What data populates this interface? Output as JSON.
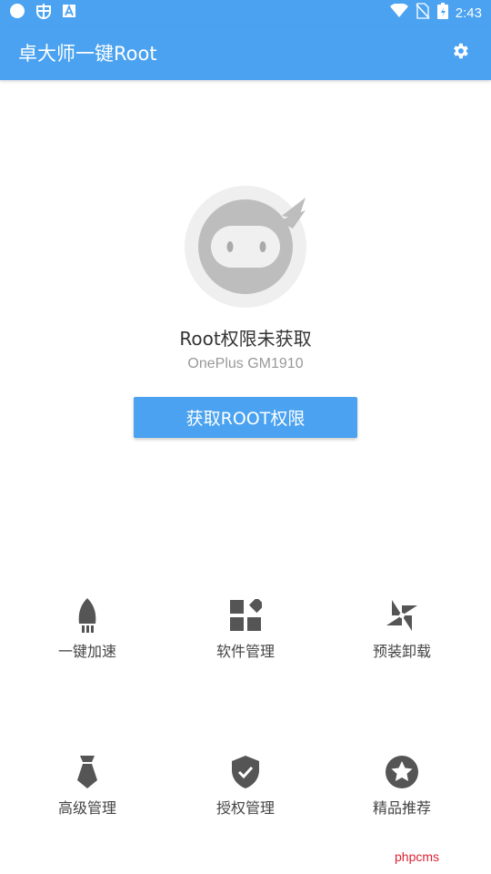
{
  "status_bar": {
    "time": "2:43",
    "icons": [
      "circle-icon",
      "bug-icon",
      "a-box-icon",
      "wifi-icon",
      "no-sim-icon",
      "battery-icon"
    ]
  },
  "app_bar": {
    "title": "卓大师一键Root",
    "settings_icon": "gear-icon"
  },
  "main": {
    "root_status": "Root权限未获取",
    "device_model": "OnePlus GM1910",
    "get_root_button": "获取ROOT权限"
  },
  "menu": {
    "items": [
      {
        "label": "一键加速",
        "icon": "rocket-icon"
      },
      {
        "label": "软件管理",
        "icon": "apps-grid-icon"
      },
      {
        "label": "预装卸载",
        "icon": "pinwheel-icon"
      },
      {
        "label": "高级管理",
        "icon": "tie-icon"
      },
      {
        "label": "授权管理",
        "icon": "shield-check-icon"
      },
      {
        "label": "精品推荐",
        "icon": "star-circle-icon"
      }
    ]
  },
  "watermark": "phpcms",
  "colors": {
    "primary": "#4aa2f0",
    "icon_gray": "#555555",
    "text_dark": "#333333",
    "text_light": "#999999"
  }
}
